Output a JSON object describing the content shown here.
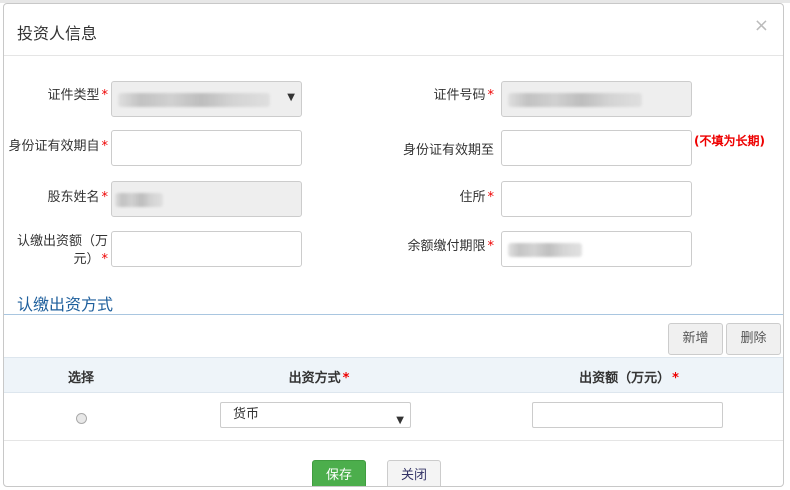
{
  "dialog": {
    "title": "投资人信息",
    "close_glyph": "×"
  },
  "form": {
    "cert_type": {
      "label": "证件类型",
      "required_mark": "*"
    },
    "cert_number": {
      "label": "证件号码",
      "required_mark": "*"
    },
    "id_valid_from": {
      "label": "身份证有效期自",
      "required_mark": "*",
      "value": ""
    },
    "id_valid_to": {
      "label": "身份证有效期至",
      "value": "",
      "hint": "(不填为长期)"
    },
    "shareholder_name": {
      "label": "股东姓名",
      "required_mark": "*"
    },
    "address": {
      "label": "住所",
      "required_mark": "*",
      "value": ""
    },
    "subscribed_amount": {
      "label_line1": "认缴出资额（万",
      "label_line2": "元）",
      "required_mark": "*",
      "value": ""
    },
    "balance_deadline": {
      "label": "余额缴付期限",
      "required_mark": "*"
    }
  },
  "section": {
    "title": "认缴出资方式",
    "add_button": "新增",
    "delete_button": "删除"
  },
  "table": {
    "headers": {
      "select": "选择",
      "method": "出资方式",
      "amount": "出资额（万元）",
      "required_mark": "*"
    },
    "rows": [
      {
        "method": "货币",
        "amount": ""
      }
    ]
  },
  "footer": {
    "save_button": "保存",
    "close_button": "关闭"
  },
  "colors": {
    "accent_blue": "#1e5f9c",
    "save_green": "#4cae4c",
    "required_red": "#ee0000"
  }
}
